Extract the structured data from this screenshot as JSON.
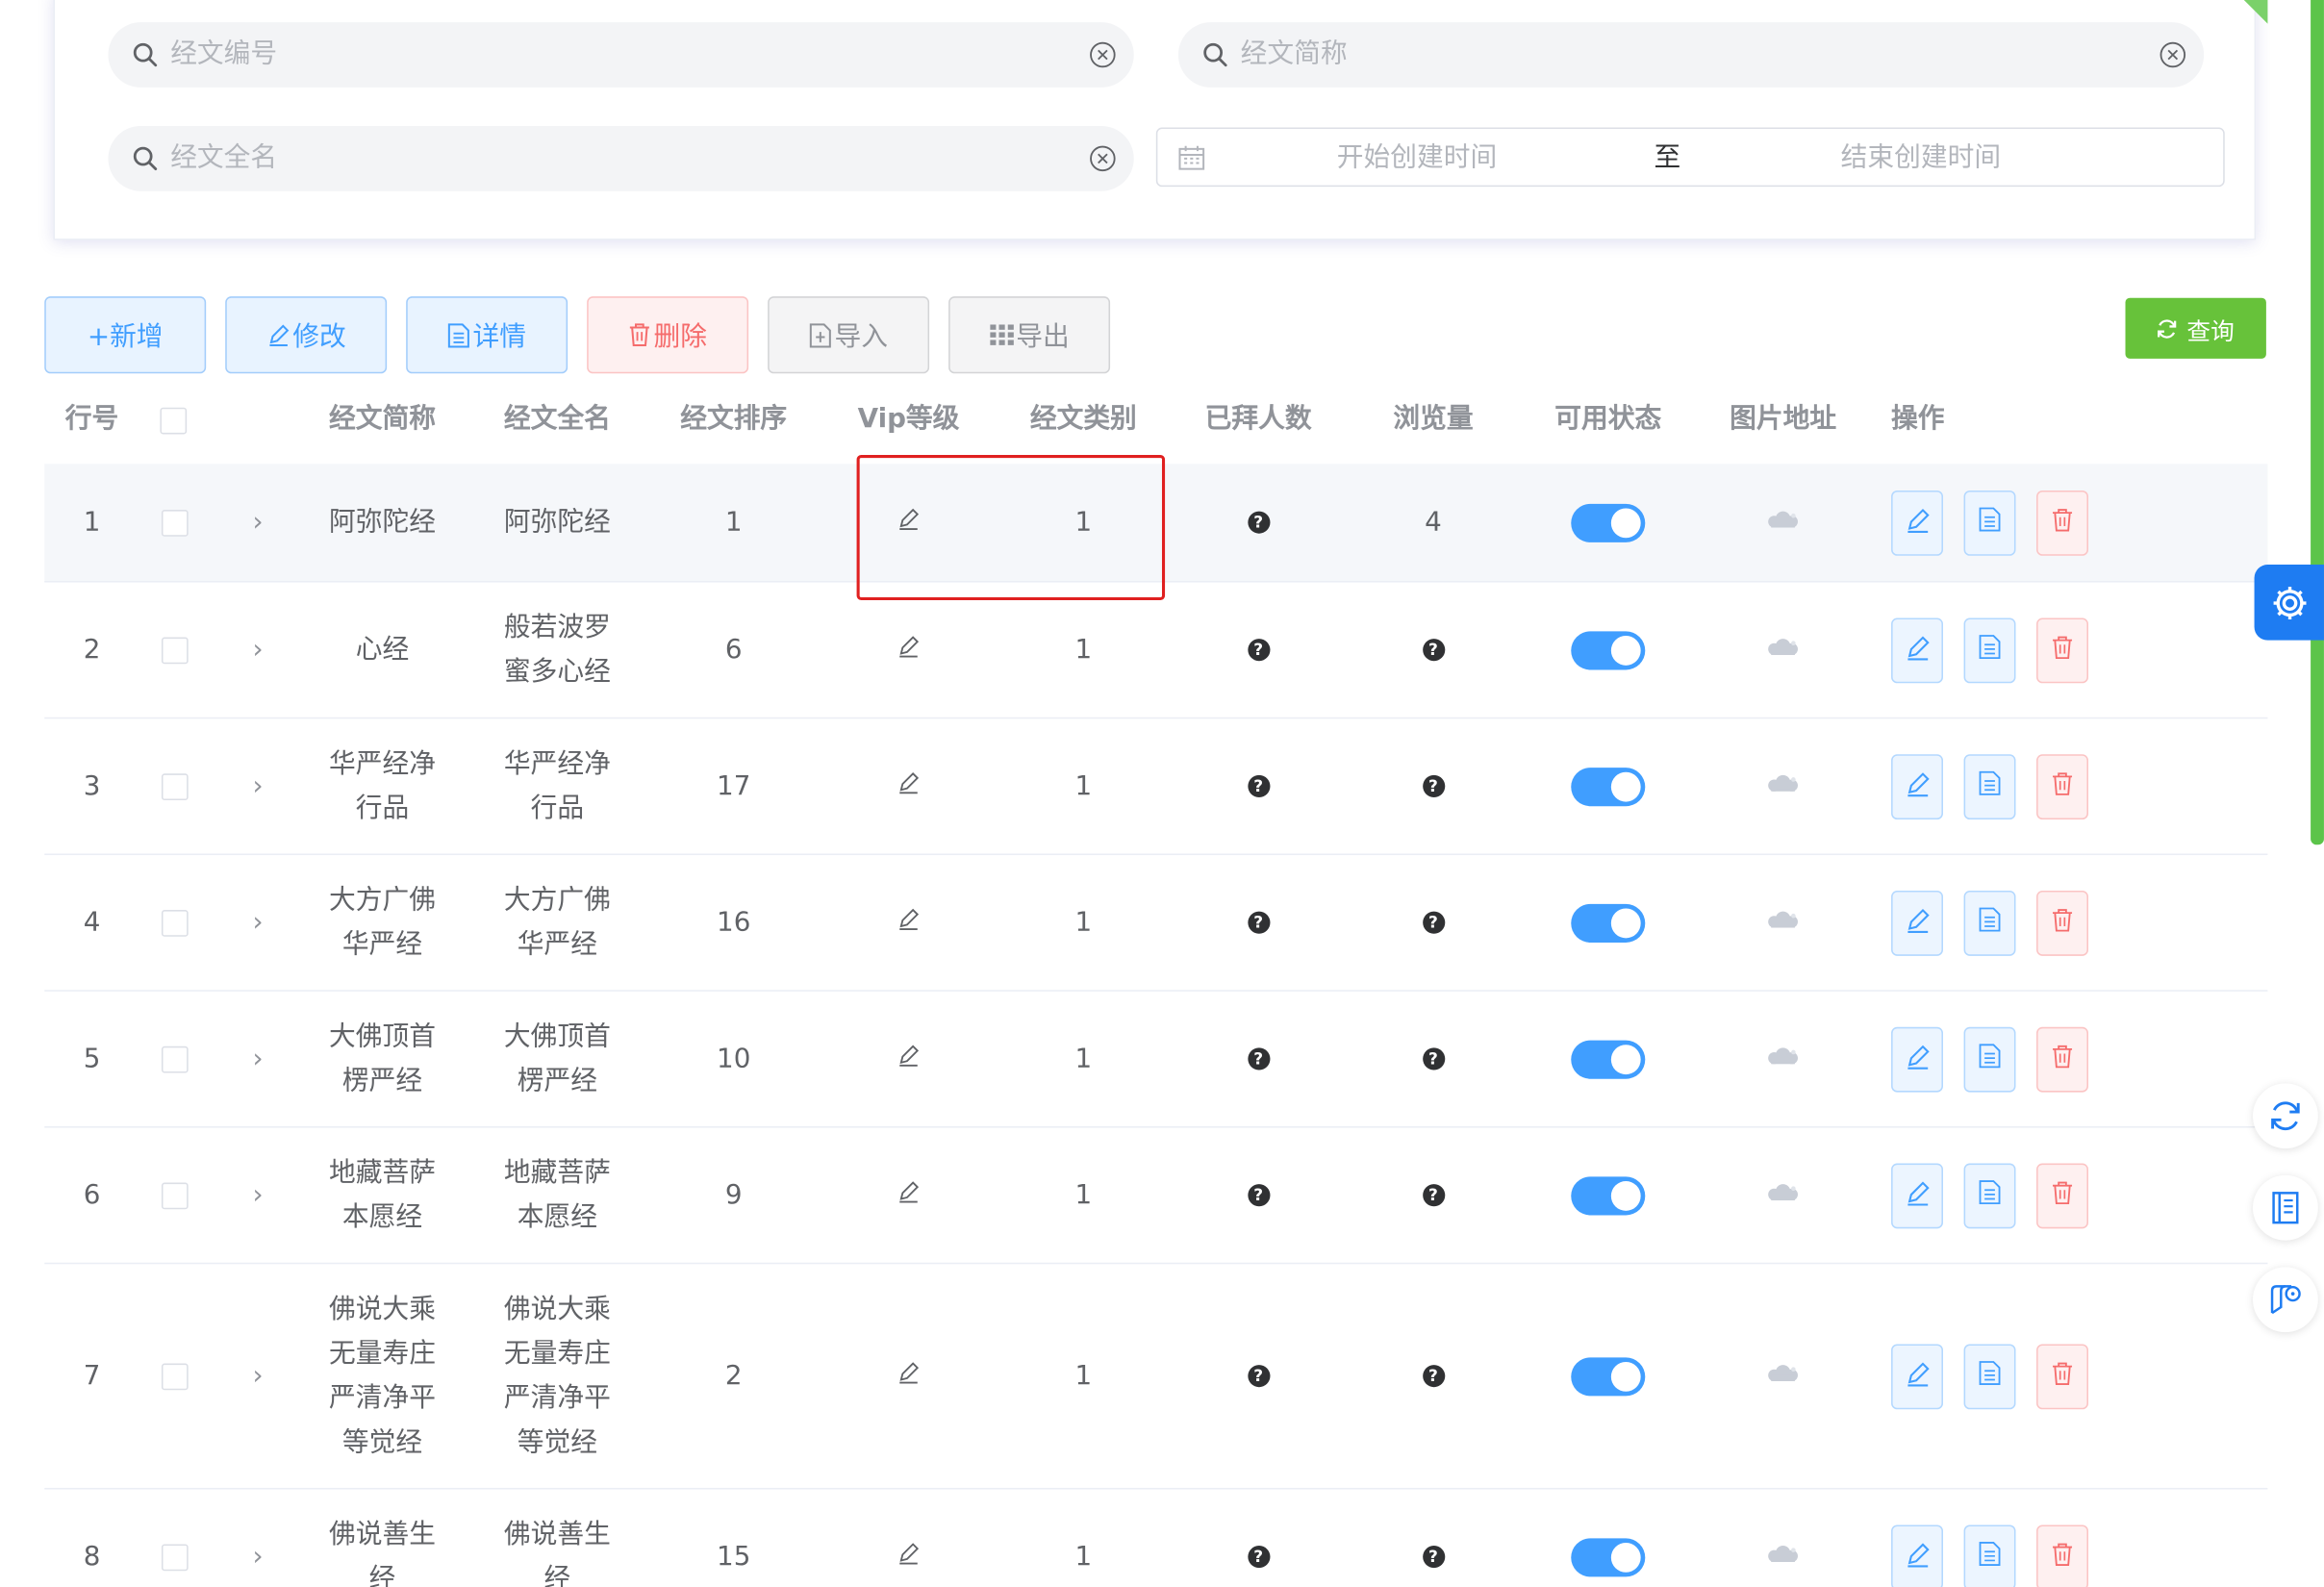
{
  "search": {
    "placeholder_code": "经文编号",
    "placeholder_short": "经文简称",
    "placeholder_full": "经文全名",
    "date_start": "开始创建时间",
    "date_sep": "至",
    "date_end": "结束创建时间"
  },
  "toolbar": {
    "add": "+新增",
    "edit": "修改",
    "detail": "详情",
    "delete": "删除",
    "import": "导入",
    "export": "导出",
    "query": "查询"
  },
  "table": {
    "headers": {
      "row_no": "行号",
      "short_name": "经文简称",
      "full_name": "经文全名",
      "sort": "经文排序",
      "vip": "Vip等级",
      "category": "经文类别",
      "worship_count": "已拜人数",
      "views": "浏览量",
      "status": "可用状态",
      "image": "图片地址",
      "actions": "操作"
    },
    "rows": [
      {
        "no": "1",
        "short": "阿弥陀经",
        "full": "阿弥陀经",
        "sort": "1",
        "category": "1",
        "views": "4",
        "enabled": true
      },
      {
        "no": "2",
        "short": "心经",
        "full": "般若波罗\n蜜多心经",
        "sort": "6",
        "category": "1",
        "views": "",
        "enabled": true
      },
      {
        "no": "3",
        "short": "华严经净\n行品",
        "full": "华严经净\n行品",
        "sort": "17",
        "category": "1",
        "views": "",
        "enabled": true
      },
      {
        "no": "4",
        "short": "大方广佛\n华严经",
        "full": "大方广佛\n华严经",
        "sort": "16",
        "category": "1",
        "views": "",
        "enabled": true
      },
      {
        "no": "5",
        "short": "大佛顶首\n楞严经",
        "full": "大佛顶首\n楞严经",
        "sort": "10",
        "category": "1",
        "views": "",
        "enabled": true
      },
      {
        "no": "6",
        "short": "地藏菩萨\n本愿经",
        "full": "地藏菩萨\n本愿经",
        "sort": "9",
        "category": "1",
        "views": "",
        "enabled": true
      },
      {
        "no": "7",
        "short": "佛说大乘\n无量寿庄\n严清净平\n等觉经",
        "full": "佛说大乘\n无量寿庄\n严清净平\n等觉经",
        "sort": "2",
        "category": "1",
        "views": "",
        "enabled": true
      },
      {
        "no": "8",
        "short": "佛说善生\n经",
        "full": "佛说善生\n经",
        "sort": "15",
        "category": "1",
        "views": "",
        "enabled": true
      }
    ]
  },
  "colors": {
    "primary": "#409eff",
    "danger": "#f56c6c",
    "success": "#67c23a",
    "highlight_box": "#e02020"
  },
  "icons": [
    "search-icon",
    "clear-icon",
    "calendar-icon",
    "edit-icon",
    "document-icon",
    "trash-icon",
    "help-icon",
    "image-icon",
    "gear-icon",
    "refresh-icon",
    "book-icon",
    "bookmark-icon"
  ]
}
